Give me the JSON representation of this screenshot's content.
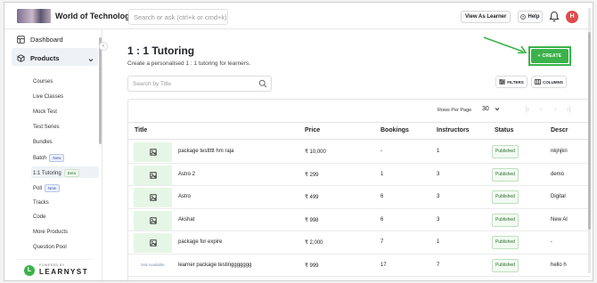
{
  "topbar": {
    "app_title": "World of Technology",
    "search_placeholder": "Search or ask (ctrl+k or cmd+k)",
    "view_as_learner": "View As Learner",
    "help": "Help",
    "avatar_letter": "H"
  },
  "sidebar": {
    "dashboard": "Dashboard",
    "products": "Products",
    "items": [
      {
        "label": "Courses",
        "tag": ""
      },
      {
        "label": "Live Classes",
        "tag": ""
      },
      {
        "label": "Mock Test",
        "tag": ""
      },
      {
        "label": "Test Series",
        "tag": ""
      },
      {
        "label": "Bundles",
        "tag": ""
      },
      {
        "label": "Batch",
        "tag": "New"
      },
      {
        "label": "1:1 Tutoring",
        "tag": "Beta"
      },
      {
        "label": "Poll",
        "tag": "New"
      },
      {
        "label": "Tracks",
        "tag": ""
      },
      {
        "label": "Code",
        "tag": ""
      },
      {
        "label": "More Products",
        "tag": ""
      },
      {
        "label": "Question Pool",
        "tag": ""
      }
    ],
    "powered_by": "POWERED BY",
    "brand": "LEARNYST"
  },
  "main": {
    "title": "1 : 1 Tutoring",
    "subtitle": "Create a personalised 1 : 1 tutoring for learners.",
    "create_label": "+ CREATE",
    "search_placeholder": "Search by Title",
    "filters_label": "FILTERS",
    "columns_label": "COLUMNS",
    "rows_per_page_label": "Rows Per Page",
    "rows_per_page_value": "30",
    "columns": [
      "Title",
      "Price",
      "Bookings",
      "Instructors",
      "Status",
      "Descr"
    ],
    "rows": [
      {
        "thumb": "image",
        "title": "package testtttt hm raja",
        "price": "₹ 10,000",
        "bookings": "-",
        "instructors": "1",
        "status": "Published",
        "desc": "nkjnjkn"
      },
      {
        "thumb": "image",
        "title": "Astro 2",
        "price": "₹ 299",
        "bookings": "1",
        "instructors": "3",
        "status": "Published",
        "desc": "demo"
      },
      {
        "thumb": "image",
        "title": "Astro",
        "price": "₹ 499",
        "bookings": "6",
        "instructors": "3",
        "status": "Published",
        "desc": "Digital"
      },
      {
        "thumb": "image",
        "title": "Akshat",
        "price": "₹ 998",
        "bookings": "6",
        "instructors": "3",
        "status": "Published",
        "desc": "New Al"
      },
      {
        "thumb": "image",
        "title": "package for expire",
        "price": "₹ 2,000",
        "bookings": "7",
        "instructors": "1",
        "status": "Published",
        "desc": "-"
      },
      {
        "thumb": "Not Available",
        "title": "learner package testinggggggg",
        "price": "₹ 999",
        "bookings": "17",
        "instructors": "7",
        "status": "Published",
        "desc": "hello h"
      }
    ]
  },
  "colors": {
    "accent": "#3bb24a",
    "avatar": "#e04a4a",
    "badge_bg": "#f2fbf2",
    "thumb_bg": "#e6f6e6"
  }
}
